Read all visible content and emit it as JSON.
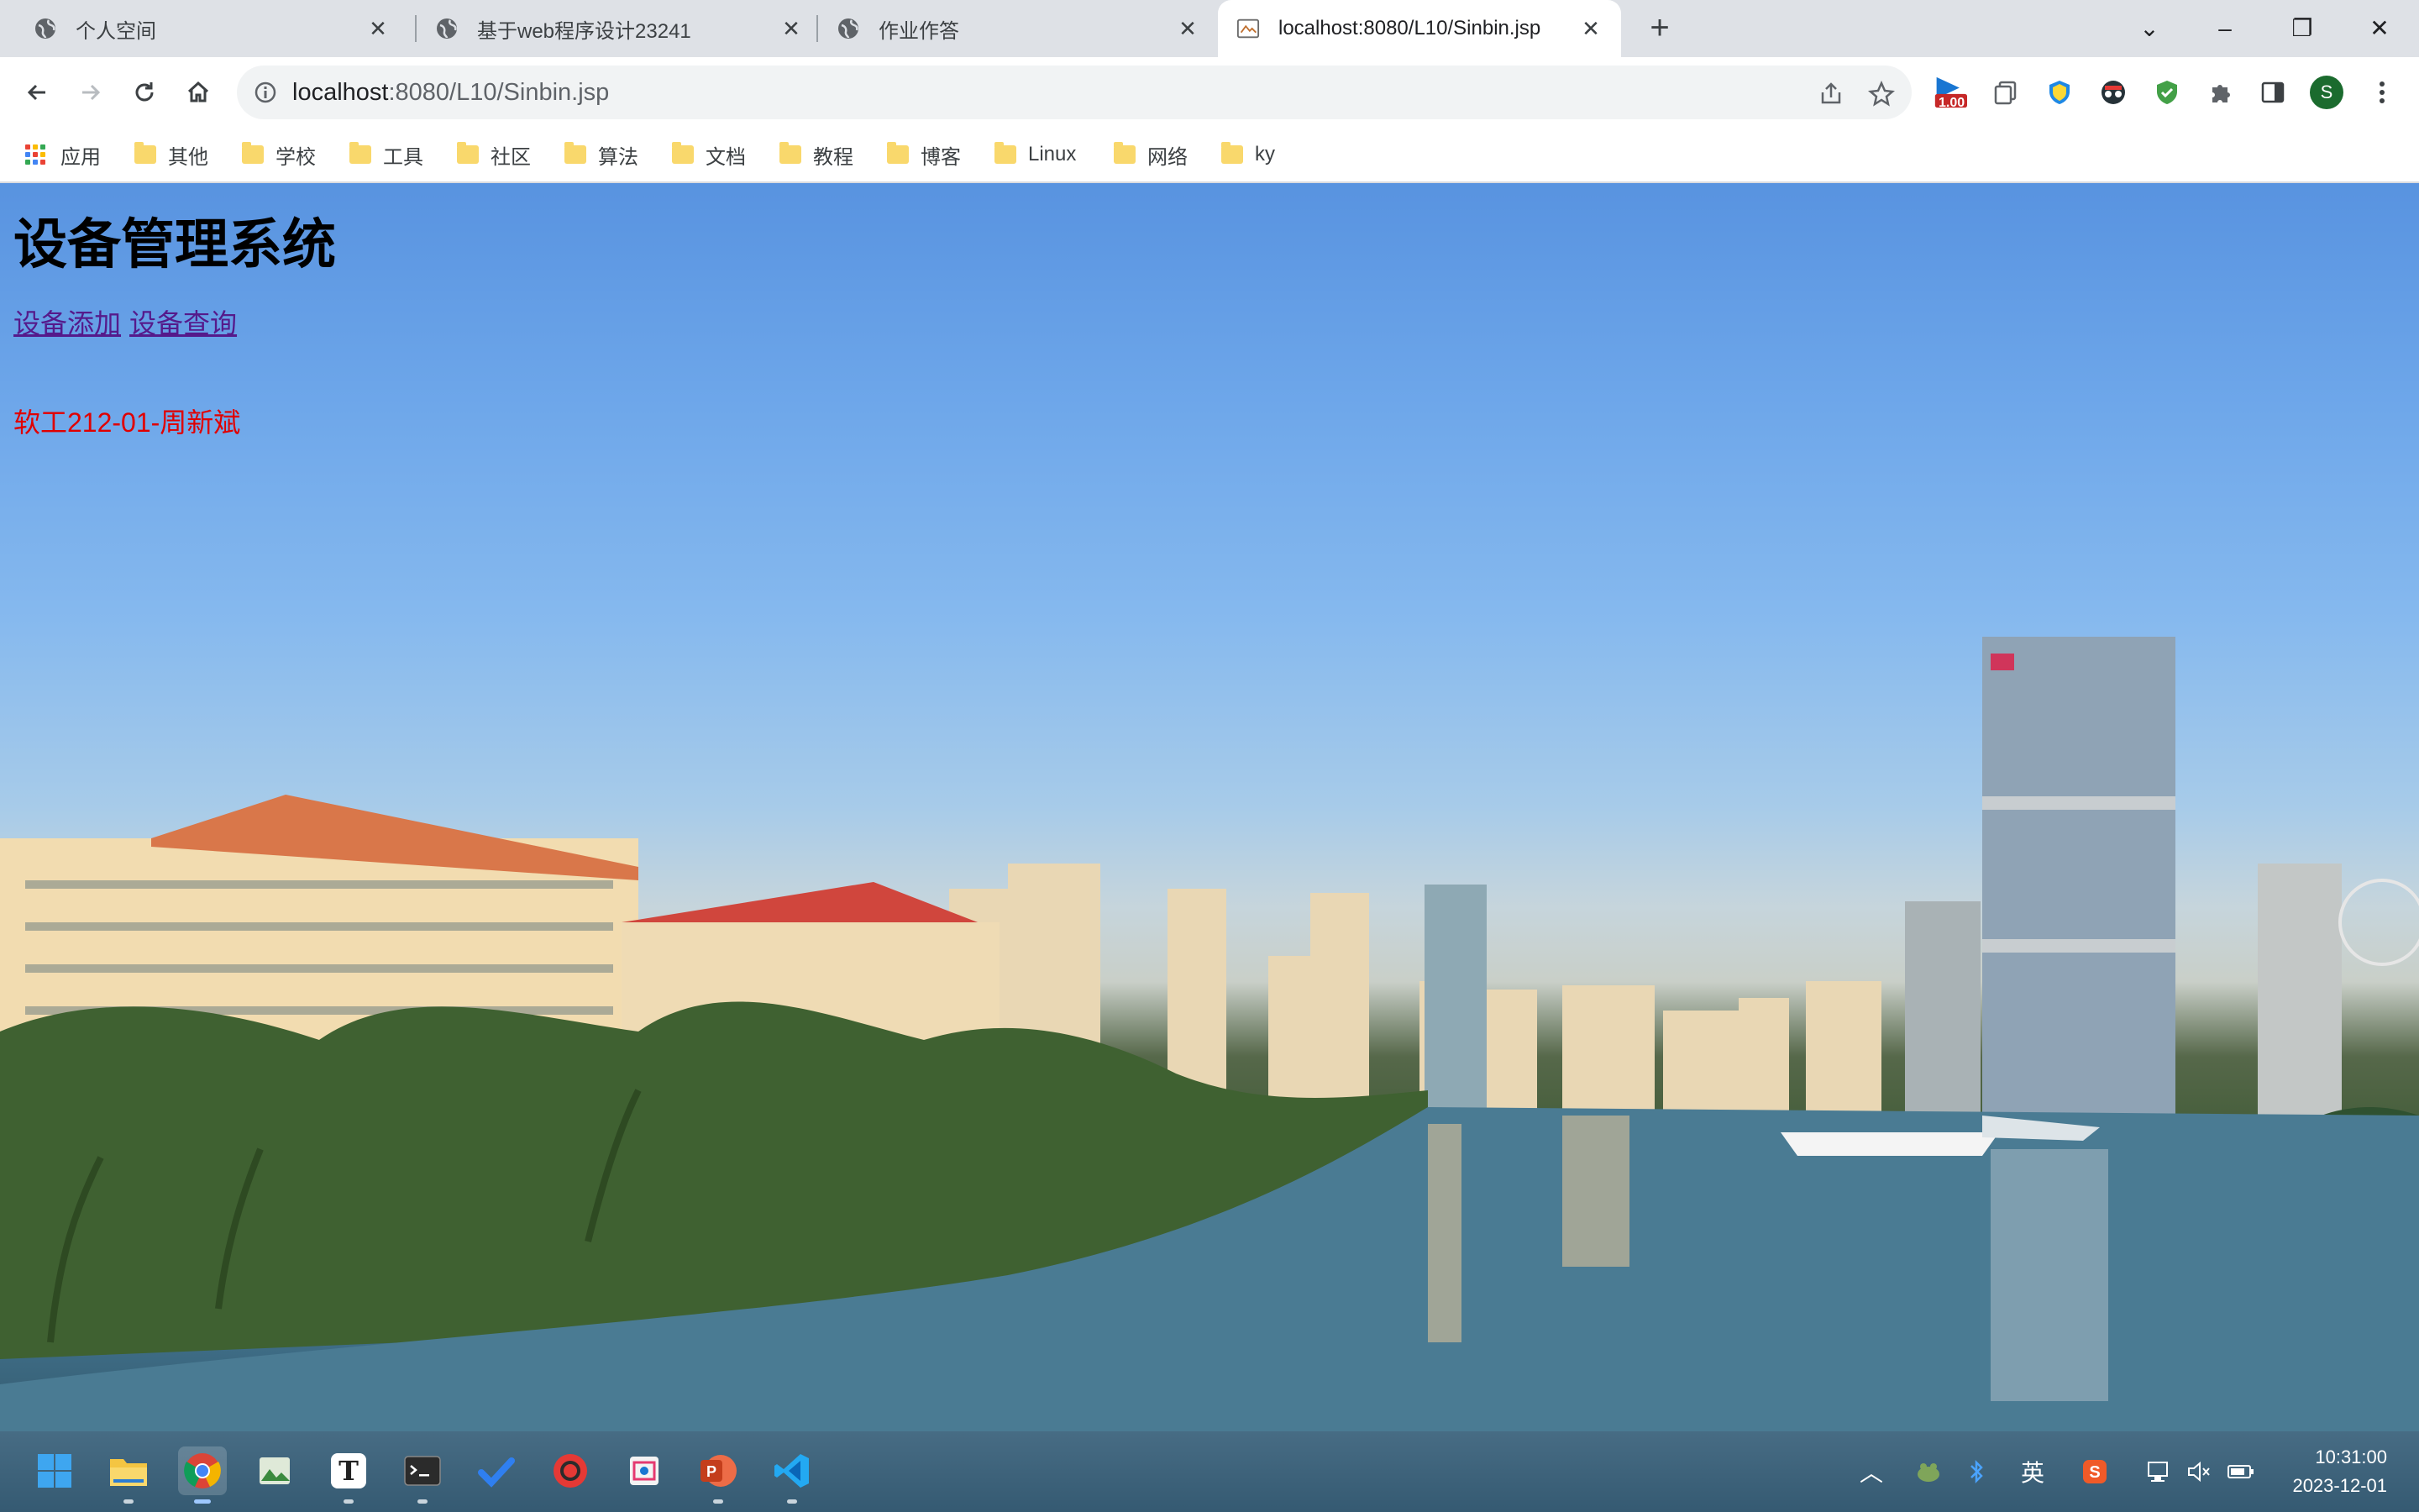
{
  "browser": {
    "tabs": [
      {
        "label": "个人空间",
        "icon": "globe-icon",
        "active": false
      },
      {
        "label": "基于web程序设计23241",
        "icon": "globe-icon",
        "active": false
      },
      {
        "label": "作业作答",
        "icon": "globe-icon",
        "active": false
      },
      {
        "label": "localhost:8080/L10/Sinbin.jsp",
        "icon": "page-icon",
        "active": true
      }
    ],
    "address": {
      "host": "localhost",
      "rest": ":8080/L10/Sinbin.jsp"
    },
    "extension_badge": "1.00",
    "profile_initial": "S",
    "bookmarks": [
      "应用",
      "其他",
      "学校",
      "工具",
      "社区",
      "算法",
      "文档",
      "教程",
      "博客",
      "Linux",
      "网络",
      "ky"
    ]
  },
  "page": {
    "title": "设备管理系统",
    "links": [
      "设备添加",
      "设备查询"
    ],
    "credit": "软工212-01-周新斌"
  },
  "taskbar": {
    "input_method": "英",
    "time": "10:31:00",
    "date": "2023-12-01"
  },
  "colors": {
    "link": "#551a8b",
    "credit": "#e00000",
    "tabstrip": "#dee1e6"
  }
}
